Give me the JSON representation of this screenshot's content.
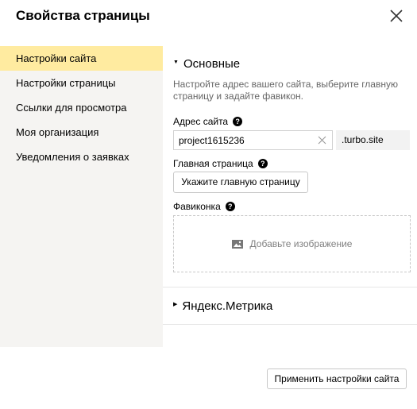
{
  "dialog": {
    "title": "Свойства страницы"
  },
  "sidebar": {
    "items": [
      {
        "label": "Настройки сайта",
        "active": true
      },
      {
        "label": "Настройки страницы",
        "active": false
      },
      {
        "label": "Ссылки для просмотра",
        "active": false
      },
      {
        "label": "Моя организация",
        "active": false
      },
      {
        "label": "Уведомления о заявках",
        "active": false
      }
    ]
  },
  "main": {
    "section_basic": {
      "title": "Основные",
      "expanded": true,
      "description": "Настройте адрес вашего сайта, выберите главную страницу и задайте фавикон.",
      "address_label": "Адрес сайта",
      "address_value": "project1615236",
      "address_suffix": ".turbo.site",
      "main_page_label": "Главная страница",
      "main_page_button": "Укажите главную страницу",
      "favicon_label": "Фавиконка",
      "favicon_add": "Добавьте изображение"
    },
    "section_metrika": {
      "title": "Яндекс.Метрика",
      "expanded": false
    }
  },
  "footer": {
    "apply_button": "Применить настройки сайта"
  },
  "icons": {
    "close": "close-icon",
    "help": "help-icon",
    "clear": "clear-icon",
    "image": "image-icon",
    "expanded": "triangle-down-icon",
    "collapsed": "triangle-right-icon"
  },
  "colors": {
    "sidebar_bg": "#f5f4f2",
    "active_item": "#ffeba0",
    "suffix_bg": "#f2f2f2"
  }
}
